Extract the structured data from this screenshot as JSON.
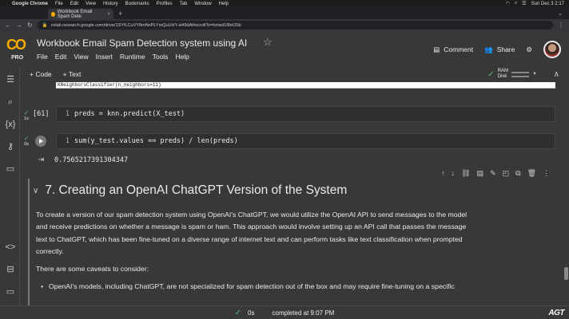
{
  "mac_menu": {
    "app": "Google Chrome",
    "items": [
      "File",
      "Edit",
      "View",
      "History",
      "Bookmarks",
      "Profiles",
      "Tab",
      "Window",
      "Help"
    ],
    "clock": "Sun Dec 3 2:17"
  },
  "browser": {
    "tab_title": "Workbook Email Spam Dete",
    "url": "colab.research.google.com/drive/1SYfLCuVY8mNnPLYmQuUHY-sl49dAl#scrollTo=hmed1f8sfJSb"
  },
  "colab": {
    "logo_text": "CO",
    "pro_label": "PRO",
    "title": "Workbook Email Spam Detection system using AI",
    "menus": [
      "File",
      "Edit",
      "View",
      "Insert",
      "Runtime",
      "Tools",
      "Help"
    ],
    "comment_label": "Comment",
    "share_label": "Share"
  },
  "toolbar": {
    "code_label": "+ Code",
    "text_label": "+ Text",
    "ram_label": "RAM",
    "disk_label": "Disk"
  },
  "cells": {
    "prev_output": "KNeighborsClassifier(n_neighbors=11)",
    "cell1": {
      "exec_count": "[61]",
      "line_no": "1",
      "code": "preds = knn.predict(X_test)",
      "time": "1s"
    },
    "cell2": {
      "line_no": "1",
      "code": "sum(y_test.values == preds) / len(preds)",
      "time": "0s",
      "output": "0.7565217391304347"
    }
  },
  "markdown": {
    "heading": "7. Creating an OpenAI ChatGPT Version of the System",
    "para1_l1": "To create a version of our spam detection system using OpenAI's ChatGPT, we would utilize the OpenAI API to send messages to the model",
    "para1_l2": "and receive predictions on whether a message is spam or ham. This approach would involve setting up an API call that passes the message",
    "para1_l3": "text to ChatGPT, which has been fine-tuned on a diverse range of internet text and can perform tasks like text classification when prompted",
    "para1_l4": "correctly.",
    "para2": "There are some caveats to consider:",
    "bullet1": "OpenAI's models, including ChatGPT, are not specialized for spam detection out of the box and may require fine-tuning on a specific"
  },
  "status": {
    "elapsed": "0s",
    "completed": "completed at 9:07 PM"
  },
  "watermark": "AGT"
}
